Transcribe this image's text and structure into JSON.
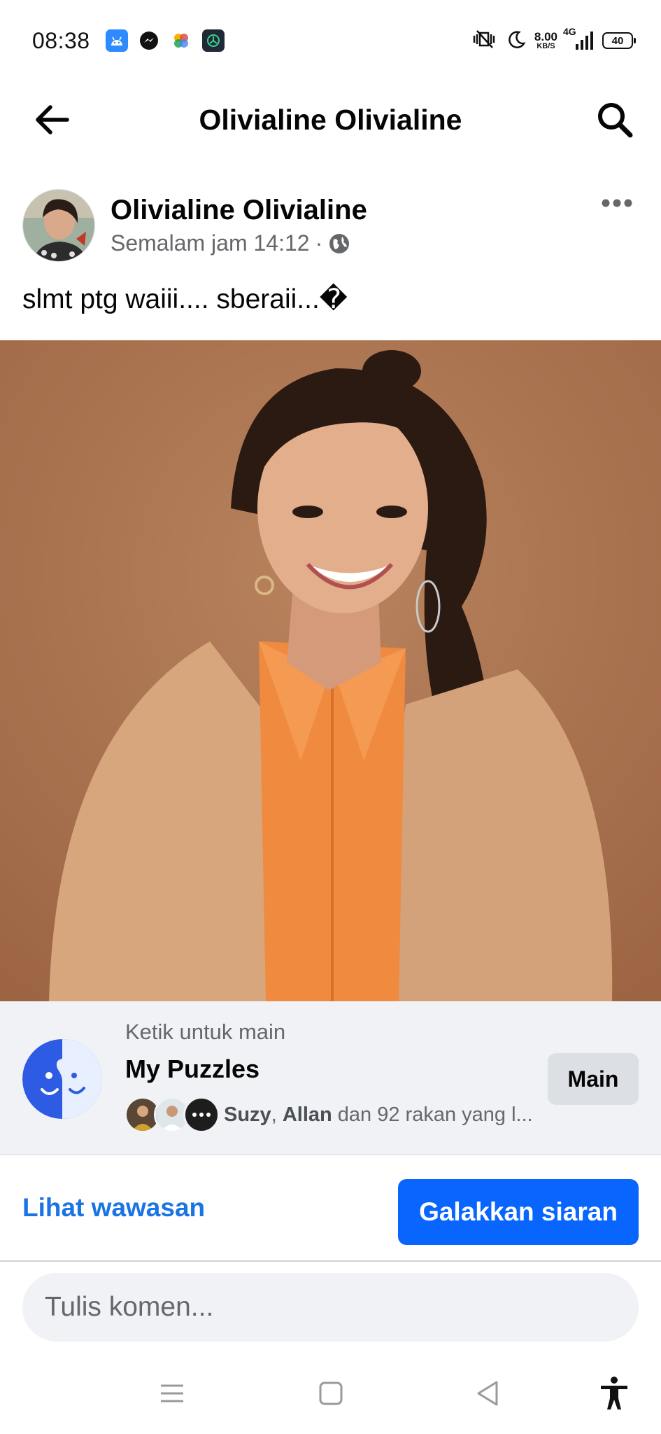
{
  "status_bar": {
    "time": "08:38",
    "net_speed_value": "8.00",
    "net_speed_unit": "KB/S",
    "network": "4G",
    "battery": "40",
    "apps": [
      "android-icon",
      "messenger-icon",
      "photos-icon",
      "shield-app-icon"
    ]
  },
  "top_nav": {
    "title": "Olivialine Olivialine"
  },
  "post": {
    "author": "Olivialine Olivialine",
    "time": "Semalam jam 14:12",
    "separator": "·",
    "text": "slmt ptg  waiii.... sberaii...�",
    "audience_icon": "globe-icon"
  },
  "game_card": {
    "subtitle": "Ketik untuk main",
    "title": "My Puzzles",
    "friend_1": "Suzy",
    "friend_sep": ", ",
    "friend_2": "Allan",
    "friends_rest": " dan 92 rakan yang l...",
    "play_label": "Main"
  },
  "actions": {
    "insights_label": "Lihat wawasan",
    "boost_label": "Galakkan siaran"
  },
  "comment": {
    "placeholder": "Tulis komen..."
  },
  "colors": {
    "accent_blue": "#0866ff",
    "link_blue": "#1b74e4",
    "card_bg": "#f0f2f5",
    "photo_bg": "#b27650"
  }
}
